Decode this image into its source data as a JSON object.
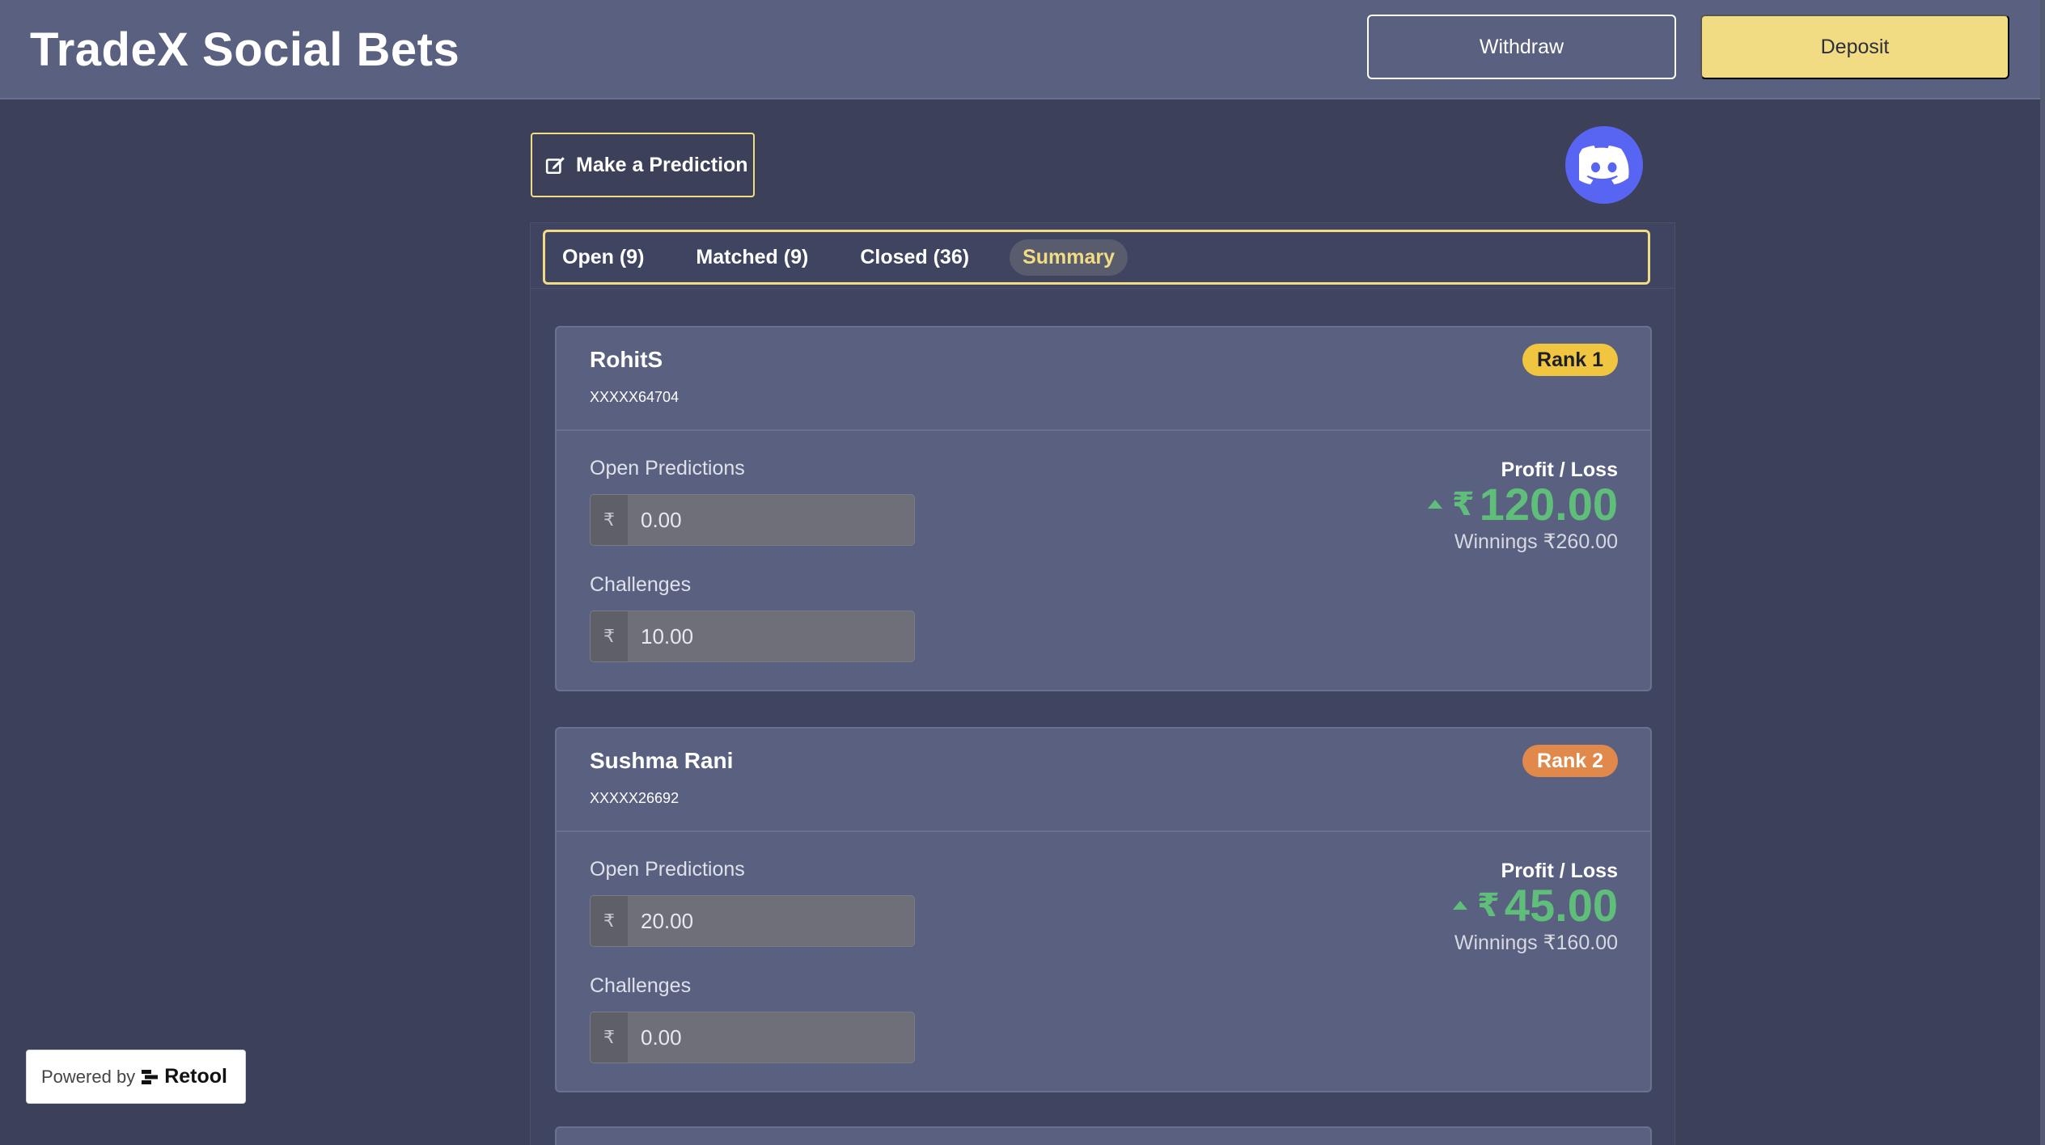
{
  "header": {
    "title": "TradeX Social Bets",
    "withdraw_label": "Withdraw",
    "deposit_label": "Deposit"
  },
  "actions": {
    "predict_label": "Make a Prediction"
  },
  "tabs": [
    {
      "label": "Open (9)"
    },
    {
      "label": "Matched (9)"
    },
    {
      "label": "Closed (36)"
    },
    {
      "label": "Summary",
      "active": true
    }
  ],
  "cards": [
    {
      "name": "RohitS",
      "phone": "XXXXX64704",
      "rank": "Rank 1",
      "open_label": "Open Predictions",
      "open_value": "0.00",
      "challenges_label": "Challenges",
      "challenges_value": "10.00",
      "currency": "₹",
      "pl_label": "Profit / Loss",
      "pl_value": "120.00",
      "winnings": "Winnings ₹260.00"
    },
    {
      "name": "Sushma Rani",
      "phone": "XXXXX26692",
      "rank": "Rank 2",
      "open_label": "Open Predictions",
      "open_value": "20.00",
      "challenges_label": "Challenges",
      "challenges_value": "0.00",
      "currency": "₹",
      "pl_label": "Profit / Loss",
      "pl_value": "45.00",
      "winnings": "Winnings ₹160.00"
    }
  ],
  "footer": {
    "powered_label": "Powered by",
    "brand": "Retool"
  },
  "colors": {
    "accent": "#f1dc84",
    "profit": "#5fbf7a",
    "rank1": "#f0c540",
    "rank2": "#e0894a",
    "discord": "#5865f2"
  }
}
